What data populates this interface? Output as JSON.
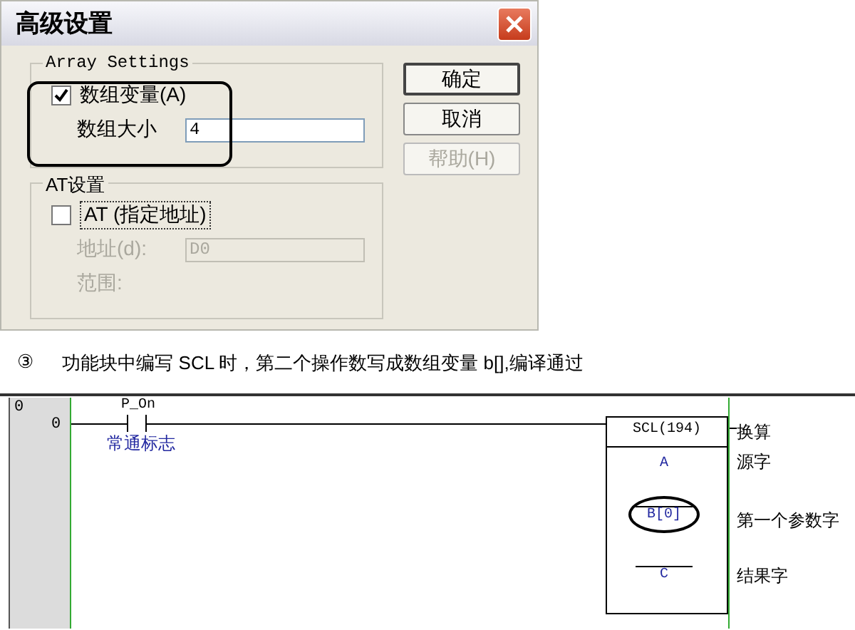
{
  "dialog": {
    "title": "高级设置",
    "groups": [
      {
        "legend": "Array Settings",
        "highlighted": true,
        "checkbox": {
          "label": "数组变量(A)",
          "checked": true
        },
        "field": {
          "label": "数组大小",
          "value": "4",
          "disabled": false
        }
      },
      {
        "legend": "AT设置",
        "highlighted": false,
        "checkbox": {
          "label": "AT (指定地址)",
          "checked": false
        },
        "field": {
          "label": "地址(d):",
          "value": "D0",
          "disabled": true
        },
        "extra_label": "范围:"
      }
    ],
    "buttons": [
      {
        "label": "确定",
        "default": true,
        "disabled": false
      },
      {
        "label": "取消",
        "default": false,
        "disabled": false
      },
      {
        "label": "帮助(H)",
        "default": false,
        "disabled": true
      }
    ]
  },
  "caption": {
    "marker": "③",
    "text": "功能块中编写 SCL 时，第二个操作数写成数组变量 b[],编译通过"
  },
  "ladder": {
    "rung_number": "0",
    "step_number": "0",
    "contact": {
      "name": "P_On",
      "comment": "常通标志"
    },
    "block": {
      "name": "SCL(194)",
      "comment": "换算",
      "operands": [
        {
          "value": "A",
          "comment": "源字",
          "highlighted": false
        },
        {
          "value": "B[0]",
          "comment": "第一个参数字",
          "highlighted": true
        },
        {
          "value": "C",
          "comment": "结果字",
          "highlighted": false
        }
      ]
    }
  }
}
